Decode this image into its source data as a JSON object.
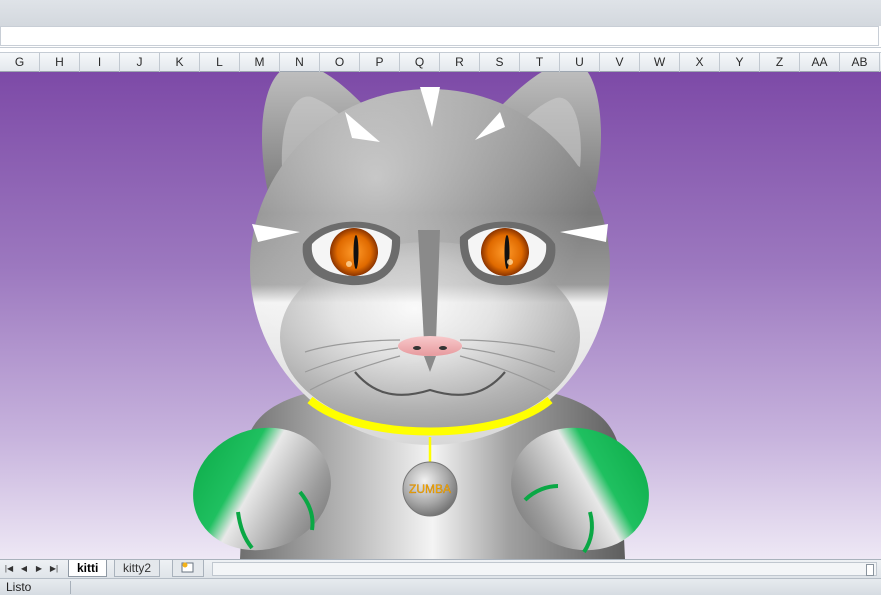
{
  "columns": [
    "G",
    "H",
    "I",
    "J",
    "K",
    "L",
    "M",
    "N",
    "O",
    "P",
    "Q",
    "R",
    "S",
    "T",
    "U",
    "V",
    "W",
    "X",
    "Y",
    "Z",
    "AA",
    "AB"
  ],
  "collar_tag": {
    "text": "ZUMBA"
  },
  "sheet_tabs": [
    {
      "label": "kitti",
      "active": true
    },
    {
      "label": "kitty2",
      "active": false
    }
  ],
  "status": {
    "text": "Listo"
  },
  "colors": {
    "background_top": "#7d4aa7",
    "background_bottom": "#eee8f5",
    "collar": "#ffff00",
    "paw_green": "#0aa845",
    "eye_iris": "#e06a00",
    "nose": "#f4b1b4",
    "tag_text": "#ffb400"
  }
}
